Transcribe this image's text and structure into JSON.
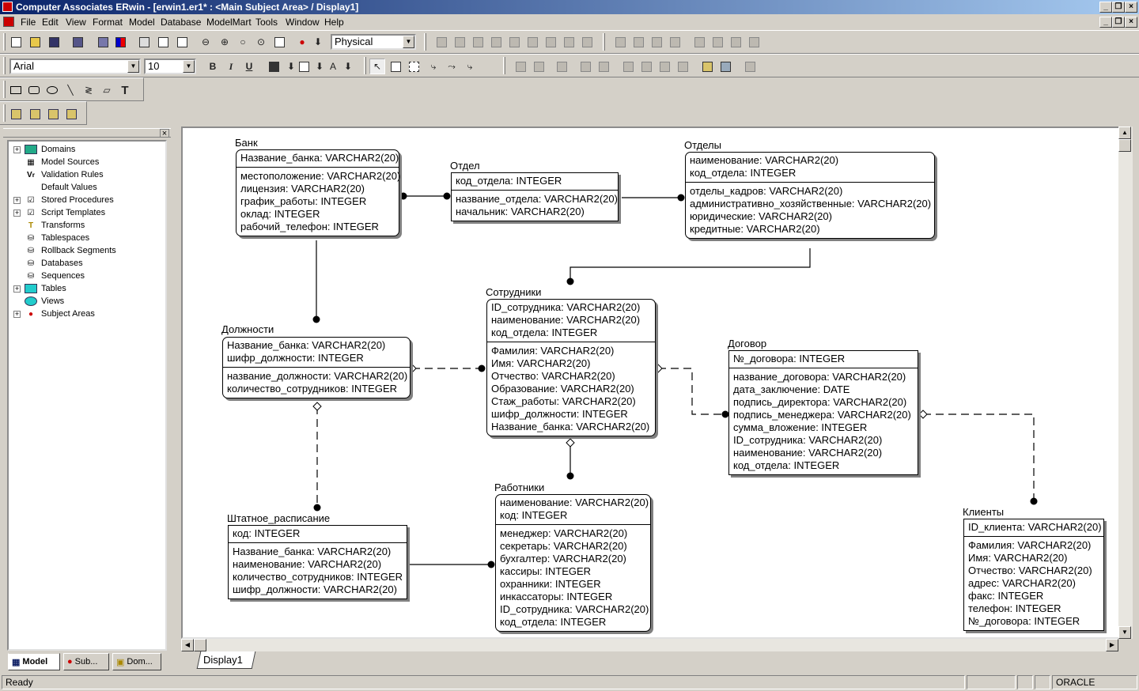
{
  "window": {
    "title": "Computer Associates ERwin - [erwin1.er1* : <Main Subject Area> / Display1]",
    "controls": [
      "_",
      "❒",
      "×"
    ]
  },
  "menu": [
    "File",
    "Edit",
    "View",
    "Format",
    "Model",
    "Database",
    "ModelMart",
    "Tools",
    "Window",
    "Help"
  ],
  "toolbar": {
    "model_type": "Physical",
    "font_name": "Arial",
    "font_size": "10",
    "bold": "B",
    "italic": "I",
    "underline": "U",
    "text_tool": "T"
  },
  "tree": {
    "close": "×",
    "items": [
      {
        "label": "Domains",
        "expand": "+",
        "icon": "folder-icon"
      },
      {
        "label": "Model Sources",
        "expand": "",
        "icon": "model-sources-icon"
      },
      {
        "label": "Validation Rules",
        "expand": "",
        "icon": "validation-rule-icon"
      },
      {
        "label": "Default Values",
        "expand": "",
        "icon": "default-value-icon"
      },
      {
        "label": "Stored Procedures",
        "expand": "+",
        "icon": "stored-procedure-icon"
      },
      {
        "label": "Script Templates",
        "expand": "+",
        "icon": "script-template-icon"
      },
      {
        "label": "Transforms",
        "expand": "",
        "icon": "transform-icon"
      },
      {
        "label": "Tablespaces",
        "expand": "",
        "icon": "tablespace-icon"
      },
      {
        "label": "Rollback Segments",
        "expand": "",
        "icon": "rollback-segment-icon"
      },
      {
        "label": "Databases",
        "expand": "",
        "icon": "database-icon"
      },
      {
        "label": "Sequences",
        "expand": "",
        "icon": "sequence-icon"
      },
      {
        "label": "Tables",
        "expand": "+",
        "icon": "table-icon"
      },
      {
        "label": "Views",
        "expand": "",
        "icon": "view-icon"
      },
      {
        "label": "Subject Areas",
        "expand": "+",
        "icon": "subject-area-icon"
      }
    ],
    "tabs": [
      "Model",
      "Sub...",
      "Dom..."
    ]
  },
  "diagram": {
    "display_tab": "Display1",
    "entities": {
      "bank": {
        "name": "Банк",
        "keys": [
          "Название_банка: VARCHAR2(20)"
        ],
        "attrs": [
          "местоположение: VARCHAR2(20)",
          "лицензия: VARCHAR2(20)",
          "график_работы: INTEGER",
          "оклад: INTEGER",
          "рабочий_телефон: INTEGER"
        ]
      },
      "otdel": {
        "name": "Отдел",
        "keys": [
          "код_отдела: INTEGER"
        ],
        "attrs": [
          "название_отдела: VARCHAR2(20)",
          "начальник: VARCHAR2(20)"
        ]
      },
      "otdely": {
        "name": "Отделы",
        "keys": [
          "наименование: VARCHAR2(20)",
          "код_отдела: INTEGER"
        ],
        "attrs": [
          "отделы_кадров: VARCHAR2(20)",
          "административно_хозяйственные: VARCHAR2(20)",
          "юридические: VARCHAR2(20)",
          "кредитные: VARCHAR2(20)"
        ]
      },
      "dolzhnosti": {
        "name": "Должности",
        "keys": [
          "Название_банка: VARCHAR2(20)",
          "шифр_должности: INTEGER"
        ],
        "attrs": [
          "название_должности: VARCHAR2(20)",
          "количество_сотрудников: INTEGER"
        ]
      },
      "sotrudniki": {
        "name": "Сотрудники",
        "keys": [
          "ID_сотрудника: VARCHAR2(20)",
          "наименование: VARCHAR2(20)",
          "код_отдела: INTEGER"
        ],
        "attrs": [
          "Фамилия: VARCHAR2(20)",
          "Имя: VARCHAR2(20)",
          "Отчество: VARCHAR2(20)",
          "Образование: VARCHAR2(20)",
          "Стаж_работы: VARCHAR2(20)",
          "шифр_должности: INTEGER",
          "Название_банка: VARCHAR2(20)"
        ]
      },
      "dogovor": {
        "name": "Договор",
        "keys": [
          "№_договора: INTEGER"
        ],
        "attrs": [
          "название_договора: VARCHAR2(20)",
          "дата_заключение: DATE",
          "подпись_директора: VARCHAR2(20)",
          "подпись_менеджера: VARCHAR2(20)",
          "сумма_вложение: INTEGER",
          "ID_сотрудника: VARCHAR2(20)",
          "наименование: VARCHAR2(20)",
          "код_отдела: INTEGER"
        ]
      },
      "shtatnoe": {
        "name": "Штатное_расписание",
        "keys": [
          "код: INTEGER"
        ],
        "attrs": [
          "Название_банка: VARCHAR2(20)",
          "наименование: VARCHAR2(20)",
          "количество_сотрудников: INTEGER",
          "шифр_должности: VARCHAR2(20)"
        ]
      },
      "rabotniki": {
        "name": "Работники",
        "keys": [
          "наименование: VARCHAR2(20)",
          "код: INTEGER"
        ],
        "attrs": [
          "менеджер: VARCHAR2(20)",
          "секретарь: VARCHAR2(20)",
          "бухгалтер: VARCHAR2(20)",
          "кассиры: INTEGER",
          "охранники: INTEGER",
          "инкассаторы: INTEGER",
          "ID_сотрудника: VARCHAR2(20)",
          "код_отдела: INTEGER"
        ]
      },
      "klienty": {
        "name": "Клиенты",
        "keys": [
          "ID_клиента: VARCHAR2(20)"
        ],
        "attrs": [
          "Фамилия: VARCHAR2(20)",
          "Имя: VARCHAR2(20)",
          "Отчество: VARCHAR2(20)",
          "адрес: VARCHAR2(20)",
          "факс: INTEGER",
          "телефон: INTEGER",
          "№_договора: INTEGER"
        ]
      }
    }
  },
  "status": {
    "text": "Ready",
    "database": "ORACLE"
  }
}
